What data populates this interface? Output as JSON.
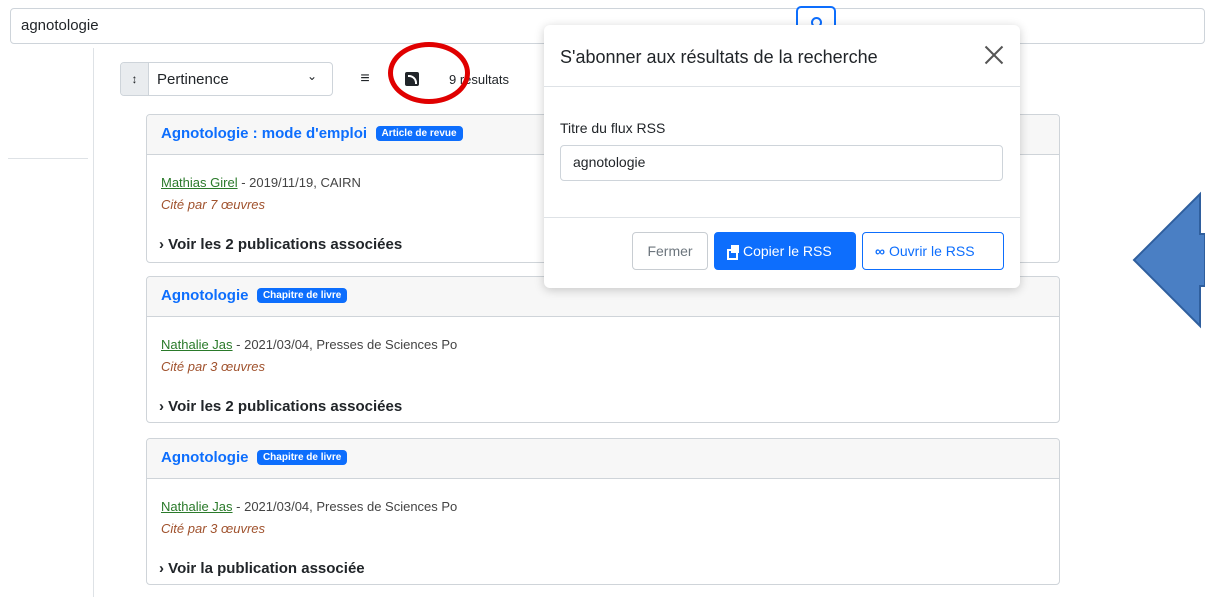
{
  "search": {
    "value": "agnotologie"
  },
  "toolbar": {
    "sort_label": "Pertinence",
    "results_count": "9 résultats"
  },
  "results": [
    {
      "title": "Agnotologie : mode d'emploi",
      "badge": "Article de revue",
      "author": "Mathias Girel",
      "meta": " - 2019/11/19, CAIRN",
      "cited": "Cité par 7 œuvres",
      "toggle": "Voir les 2 publications associées"
    },
    {
      "title": "Agnotologie",
      "badge": "Chapitre de livre",
      "author": "Nathalie Jas",
      "meta": " - 2021/03/04, Presses de Sciences Po",
      "cited": "Cité par 3 œuvres",
      "toggle": "Voir les 2 publications associées"
    },
    {
      "title": "Agnotologie",
      "badge": "Chapitre de livre",
      "author": "Nathalie Jas",
      "meta": " - 2021/03/04, Presses de Sciences Po",
      "cited": "Cité par 3 œuvres",
      "toggle": "Voir la publication associée"
    }
  ],
  "modal": {
    "title": "S'abonner aux résultats de la recherche",
    "field_label": "Titre du flux RSS",
    "field_value": "agnotologie",
    "close_label": "Fermer",
    "copy_label": "Copier le RSS",
    "open_label": "Ouvrir le RSS"
  },
  "colors": {
    "accent": "#0d6efd",
    "highlight_circle": "#e00000",
    "arrow": "#4a7fc4"
  }
}
